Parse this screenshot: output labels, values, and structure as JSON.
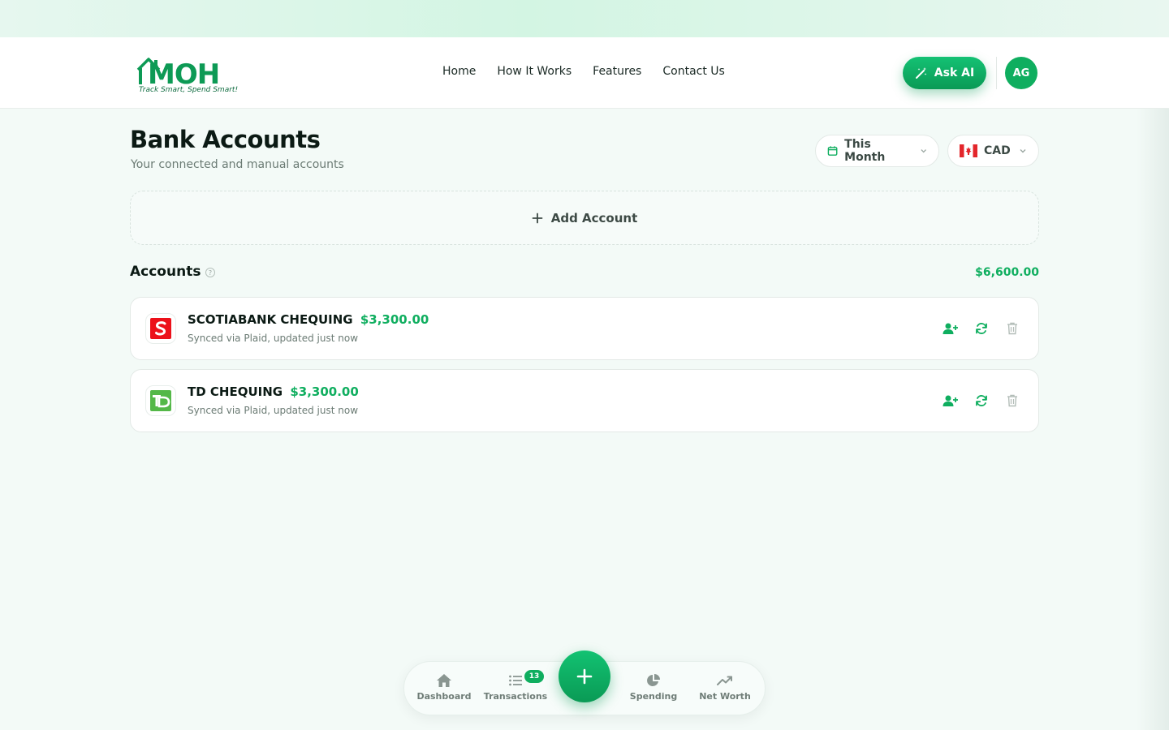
{
  "brand": {
    "name": "MOH",
    "tagline": "Track Smart, Spend Smart!",
    "color": "#0d9a55"
  },
  "nav": {
    "items": [
      "Home",
      "How It Works",
      "Features",
      "Contact Us"
    ]
  },
  "header": {
    "ask_ai_label": "Ask AI",
    "avatar_initials": "AG"
  },
  "page": {
    "title": "Bank Accounts",
    "subtitle": "Your connected and manual accounts"
  },
  "filters": {
    "period": "This Month",
    "currency": "CAD"
  },
  "add_account_label": "Add Account",
  "accounts": {
    "title": "Accounts",
    "total": "$6,600.00",
    "items": [
      {
        "name": "SCOTIABANK CHEQUING",
        "amount": "$3,300.00",
        "sync": "Synced via Plaid, updated just now",
        "logo_icon": "scotiabank-logo-icon",
        "logo_color": "#ec111a"
      },
      {
        "name": "TD CHEQUING",
        "amount": "$3,300.00",
        "sync": "Synced via Plaid, updated just now",
        "logo_icon": "td-logo-icon",
        "logo_color": "#54b848"
      }
    ]
  },
  "bottom_nav": {
    "dashboard": "Dashboard",
    "transactions": "Transactions",
    "transactions_badge": "13",
    "spending": "Spending",
    "net_worth": "Net Worth"
  },
  "colors": {
    "accent": "#0fae5f",
    "text": "#0b1a14",
    "muted": "#6b7b74",
    "background": "#f3faf7"
  }
}
